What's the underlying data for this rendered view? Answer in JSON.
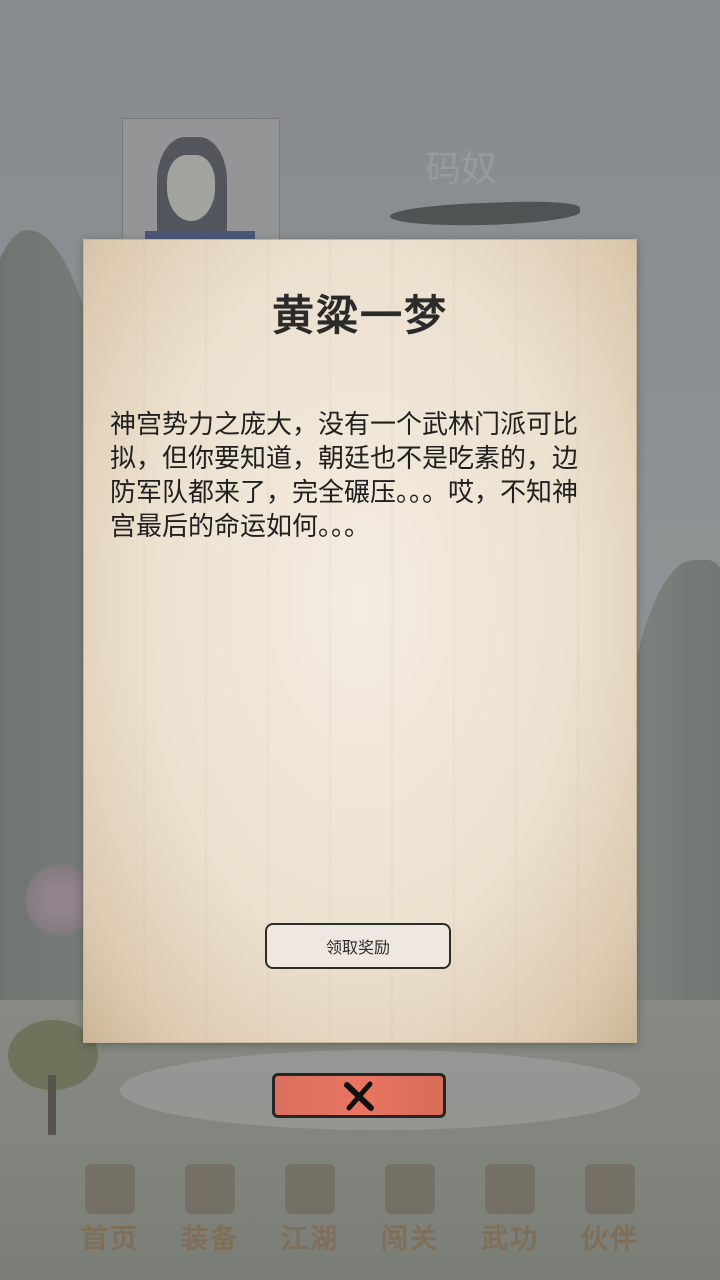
{
  "player": {
    "name": "码奴"
  },
  "dialog": {
    "title": "黄粱一梦",
    "text": "神宫势力之庞大，没有一个武林门派可比拟，但你要知道，朝廷也不是吃素的，边防军队都来了，完全碾压。。。哎，不知神宫最后的命运如何。。。",
    "claim_label": "领取奖励",
    "close_icon": "close-x-icon"
  },
  "nav": {
    "items": [
      {
        "label": "首页",
        "icon": "pavilion-icon"
      },
      {
        "label": "装备",
        "icon": "armor-icon"
      },
      {
        "label": "江湖",
        "icon": "scroll-icon"
      },
      {
        "label": "闯关",
        "icon": "crossed-swords-icon"
      },
      {
        "label": "武功",
        "icon": "book-icon"
      },
      {
        "label": "伙伴",
        "icon": "companions-icon"
      }
    ]
  },
  "colors": {
    "dialog_paper": "#efe5d5",
    "close_button": "#e97560",
    "nav_label": "#8a5a2c"
  }
}
